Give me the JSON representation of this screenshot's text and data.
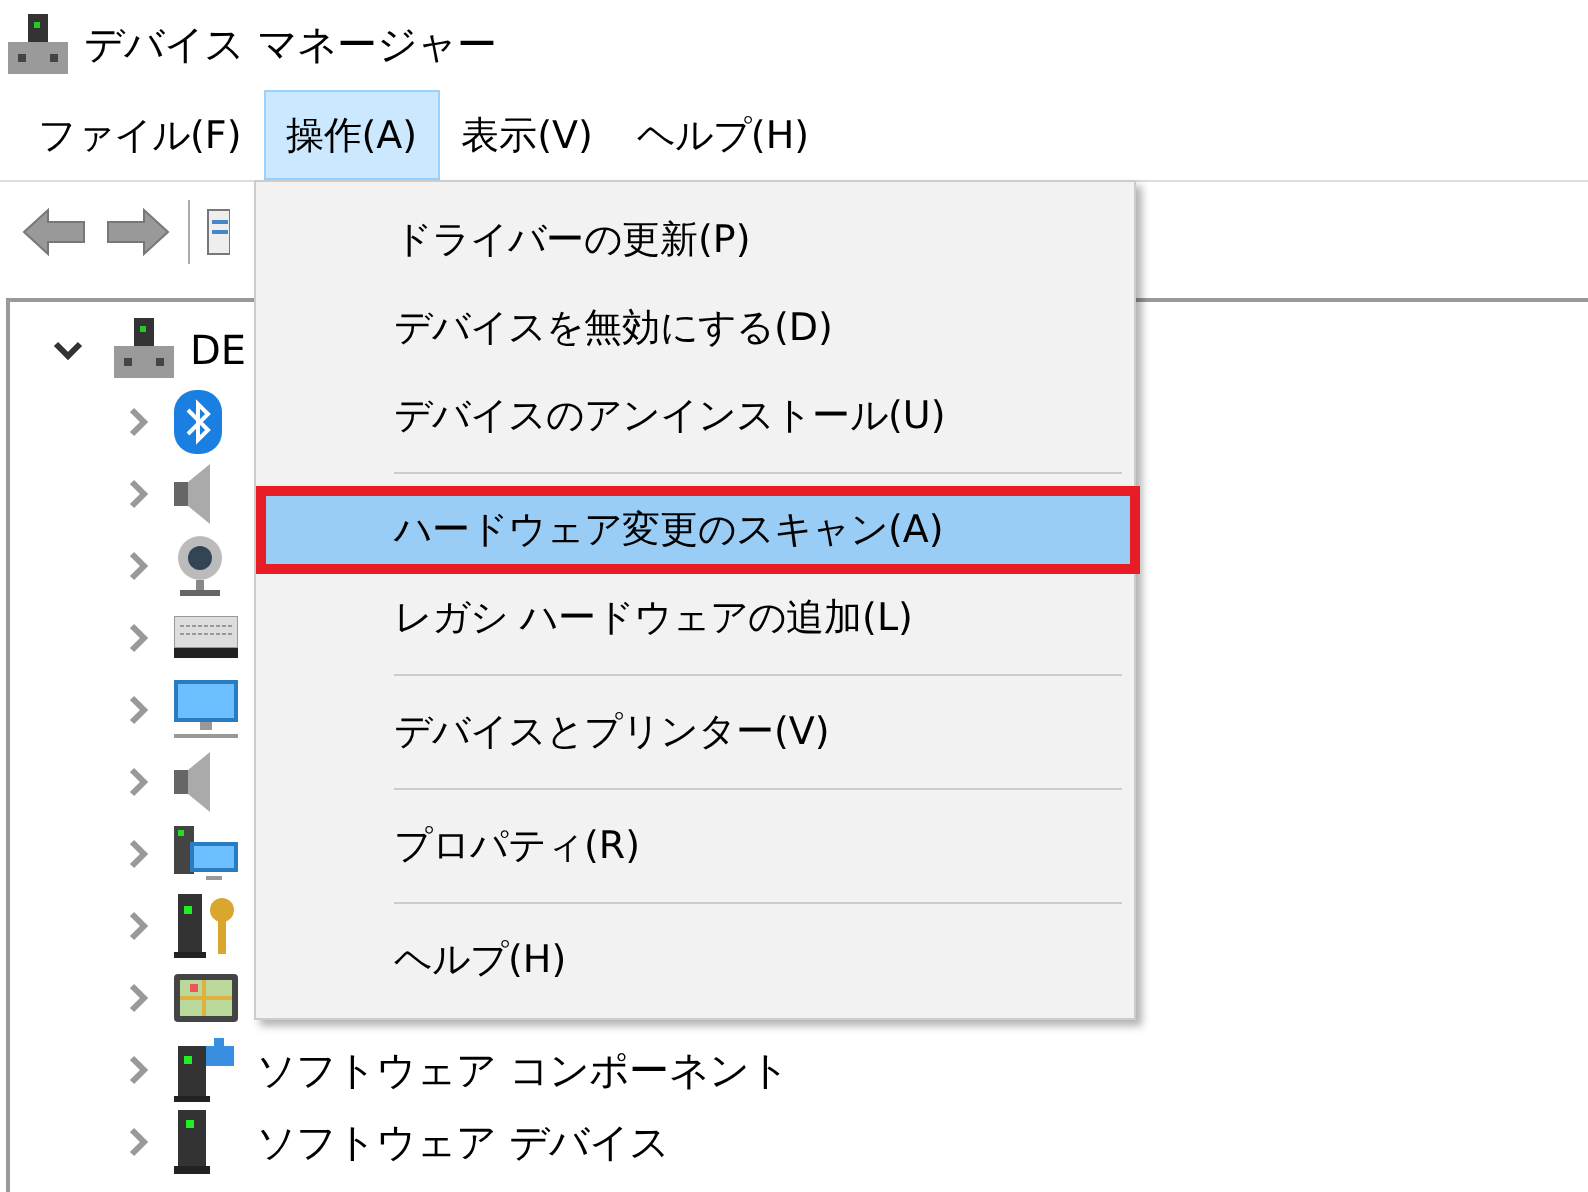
{
  "window": {
    "title": "デバイス マネージャー"
  },
  "menu_bar": [
    {
      "label": "ファイル(F)",
      "selected": false
    },
    {
      "label": "操作(A)",
      "selected": true
    },
    {
      "label": "表示(V)",
      "selected": false
    },
    {
      "label": "ヘルプ(H)",
      "selected": false
    }
  ],
  "toolbar": [
    {
      "kind": "back"
    },
    {
      "kind": "forward"
    },
    {
      "kind": "separator"
    },
    {
      "kind": "list"
    }
  ],
  "tree": {
    "label": "DE",
    "expanded": true,
    "children": [
      {
        "kind": "bluetooth",
        "expanded": false
      },
      {
        "kind": "speaker",
        "expanded": false
      },
      {
        "kind": "webcam",
        "expanded": false
      },
      {
        "kind": "keyboard",
        "expanded": false
      },
      {
        "kind": "monitor",
        "expanded": false
      },
      {
        "kind": "speaker",
        "expanded": false
      },
      {
        "kind": "computer",
        "expanded": false
      },
      {
        "kind": "tower-key",
        "expanded": false
      },
      {
        "kind": "map",
        "expanded": false
      },
      {
        "kind": "tower-puzzle",
        "expanded": false,
        "label": "ソフトウェア コンポーネント"
      },
      {
        "kind": "tower",
        "expanded": false,
        "label": "ソフトウェア デバイス"
      }
    ]
  },
  "dropdown_menu": [
    {
      "kind": "item",
      "label": "ドライバーの更新(P)",
      "selected": false,
      "marked": false
    },
    {
      "kind": "item",
      "label": "デバイスを無効にする(D)",
      "selected": false,
      "marked": false
    },
    {
      "kind": "item",
      "label": "デバイスのアンインストール(U)",
      "selected": false,
      "marked": false
    },
    {
      "kind": "separator"
    },
    {
      "kind": "item",
      "label": "ハードウェア変更のスキャン(A)",
      "selected": true,
      "marked": true
    },
    {
      "kind": "item",
      "label": "レガシ ハードウェアの追加(L)",
      "selected": false,
      "marked": false
    },
    {
      "kind": "separator"
    },
    {
      "kind": "item",
      "label": "デバイスとプリンター(V)",
      "selected": false,
      "marked": false
    },
    {
      "kind": "separator"
    },
    {
      "kind": "item",
      "label": "プロパティ(R)",
      "selected": false,
      "marked": false
    },
    {
      "kind": "separator"
    },
    {
      "kind": "item",
      "label": "ヘルプ(H)",
      "selected": false,
      "marked": false
    }
  ]
}
